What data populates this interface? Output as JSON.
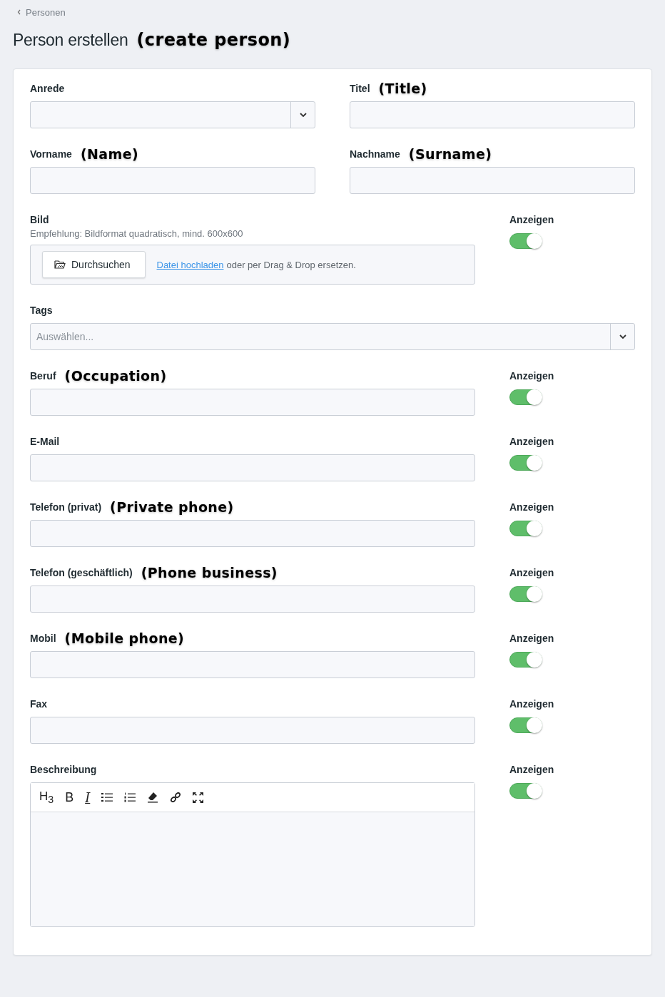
{
  "breadcrumb": {
    "label": "Personen"
  },
  "title": {
    "text": "Person erstellen",
    "note": "(create person)"
  },
  "pair_rows": [
    [
      {
        "label": "Anrede",
        "kind": "select"
      },
      {
        "label": "Titel",
        "note": "(Title)",
        "kind": "text"
      }
    ],
    [
      {
        "label": "Vorname",
        "note": "(Name)",
        "kind": "text"
      },
      {
        "label": "Nachname",
        "note": "(Surname)",
        "kind": "text"
      }
    ]
  ],
  "image": {
    "label": "Bild",
    "hint": "Empfehlung: Bildformat quadratisch, mind. 600x600",
    "browse_button": "Durchsuchen",
    "upload_link": "Datei hochladen",
    "drop_text": "oder per Drag & Drop ersetzen.",
    "toggle": {
      "label": "Anzeigen",
      "on": true
    }
  },
  "tags": {
    "label": "Tags",
    "placeholder": "Auswählen..."
  },
  "fields": [
    {
      "label": "Beruf",
      "note": "(Occupation)",
      "kind": "text",
      "toggle": {
        "label": "Anzeigen",
        "on": true
      }
    },
    {
      "label": "E-Mail",
      "kind": "text",
      "toggle": {
        "label": "Anzeigen",
        "on": true
      }
    },
    {
      "label": "Telefon (privat)",
      "note": "(Private phone)",
      "kind": "text",
      "toggle": {
        "label": "Anzeigen",
        "on": true
      }
    },
    {
      "label": "Telefon (geschäftlich)",
      "note": "(Phone business)",
      "kind": "text",
      "toggle": {
        "label": "Anzeigen",
        "on": true
      }
    },
    {
      "label": "Mobil",
      "note": "(Mobile phone)",
      "kind": "text",
      "toggle": {
        "label": "Anzeigen",
        "on": true
      }
    },
    {
      "label": "Fax",
      "kind": "text",
      "toggle": {
        "label": "Anzeigen",
        "on": true
      }
    },
    {
      "label": "Beschreibung",
      "kind": "editor",
      "toggle": {
        "label": "Anzeigen",
        "on": true
      },
      "toolbar": [
        {
          "kind": "heading",
          "label": "H$_{3}$"
        },
        {
          "kind": "bold",
          "label": "B"
        },
        {
          "kind": "italic",
          "label": "I"
        },
        {
          "kind": "bullet-list"
        },
        {
          "kind": "numbered-list"
        },
        {
          "kind": "eraser"
        },
        {
          "kind": "link"
        },
        {
          "kind": "fullscreen"
        }
      ]
    }
  ]
}
